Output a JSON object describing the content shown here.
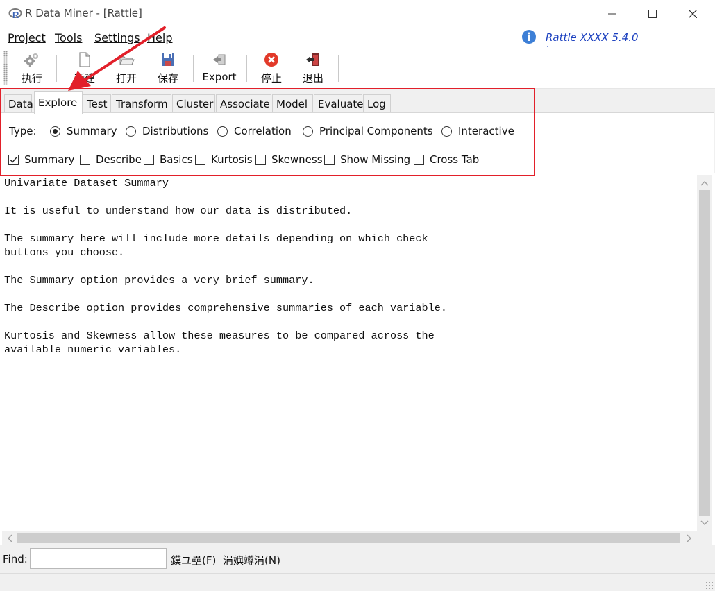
{
  "window": {
    "title": "R Data Miner - [Rattle]",
    "app_icon": "r-logo-icon",
    "controls": [
      "minimize-icon",
      "maximize-icon",
      "close-icon"
    ]
  },
  "menubar": {
    "items": [
      {
        "label": "Project",
        "underline_index": 0
      },
      {
        "label": "Tools",
        "underline_index": 0
      },
      {
        "label": "Settings",
        "underline_index": 0
      },
      {
        "label": "Help",
        "underline_index": 0
      }
    ],
    "version_text": "Rattle XXXX 5.4.0",
    "version_link": "togaware.com"
  },
  "toolbar": {
    "buttons": [
      {
        "label": "执行",
        "icon": "execute-gears-icon"
      },
      {
        "label": "新建",
        "icon": "new-document-icon"
      },
      {
        "label": "打开",
        "icon": "open-folder-icon"
      },
      {
        "label": "保存",
        "icon": "save-disk-icon"
      },
      {
        "label": "Export",
        "icon": "export-icon"
      },
      {
        "label": "停止",
        "icon": "stop-icon"
      },
      {
        "label": "退出",
        "icon": "quit-door-icon"
      }
    ]
  },
  "tabs": {
    "items": [
      "Data",
      "Explore",
      "Test",
      "Transform",
      "Cluster",
      "Associate",
      "Model",
      "Evaluate",
      "Log"
    ],
    "active": "Explore"
  },
  "explore": {
    "type_label": "Type:",
    "radios": [
      {
        "label": "Summary",
        "selected": true
      },
      {
        "label": "Distributions",
        "selected": false
      },
      {
        "label": "Correlation",
        "selected": false
      },
      {
        "label": "Principal Components",
        "selected": false
      },
      {
        "label": "Interactive",
        "selected": false
      }
    ],
    "checks": [
      {
        "label": "Summary",
        "checked": true
      },
      {
        "label": "Describe",
        "checked": false
      },
      {
        "label": "Basics",
        "checked": false
      },
      {
        "label": "Kurtosis",
        "checked": false
      },
      {
        "label": "Skewness",
        "checked": false
      },
      {
        "label": "Show Missing",
        "checked": false
      },
      {
        "label": "Cross Tab",
        "checked": false
      }
    ]
  },
  "output": {
    "text": "Univariate Dataset Summary\n\nIt is useful to understand how our data is distributed.\n\nThe summary here will include more details depending on which check\nbuttons you choose.\n\nThe Summary option provides a very brief summary.\n\nThe Describe option provides comprehensive summaries of each variable.\n\nKurtosis and Skewness allow these measures to be compared across the\navailable numeric variables."
  },
  "findbar": {
    "label": "Find:",
    "value": "",
    "next_label": "鏌ユ壘(F)",
    "prev_label": "涓嬩竴涓(N)"
  },
  "annotation": {
    "highlight_color": "#e2202a"
  }
}
